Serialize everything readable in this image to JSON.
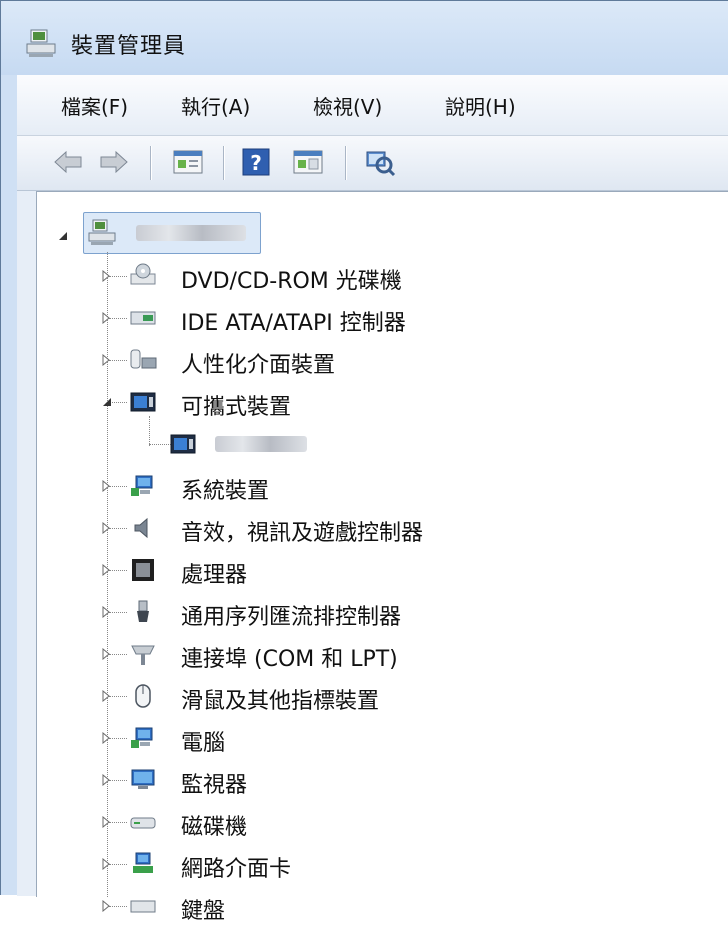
{
  "window": {
    "title": "裝置管理員"
  },
  "menu": [
    "檔案(F)",
    "執行(A)",
    "檢視(V)",
    "說明(H)"
  ],
  "toolbar": [
    "back-icon",
    "forward-icon",
    "properties-icon",
    "help-icon",
    "action-pane-icon",
    "scan-hardware-icon"
  ],
  "tree": {
    "root": {
      "label": "",
      "expanded": true
    },
    "items": [
      {
        "label": "DVD/CD-ROM 光碟機",
        "icon": "dvd-drive-icon",
        "expanded": false
      },
      {
        "label": "IDE ATA/ATAPI 控制器",
        "icon": "ide-controller-icon",
        "expanded": false
      },
      {
        "label": "人性化介面裝置",
        "icon": "hid-icon",
        "expanded": false
      },
      {
        "label": "可攜式裝置",
        "icon": "portable-device-icon",
        "expanded": true
      },
      {
        "label": "",
        "icon": "portable-device-icon",
        "child": true
      },
      {
        "label": "系統裝置",
        "icon": "system-device-icon",
        "expanded": false
      },
      {
        "label": "音效，視訊及遊戲控制器",
        "icon": "speaker-icon",
        "expanded": false
      },
      {
        "label": "處理器",
        "icon": "processor-icon",
        "expanded": false
      },
      {
        "label": "通用序列匯流排控制器",
        "icon": "usb-icon",
        "expanded": false
      },
      {
        "label": "連接埠 (COM 和 LPT)",
        "icon": "port-icon",
        "expanded": false
      },
      {
        "label": "滑鼠及其他指標裝置",
        "icon": "mouse-icon",
        "expanded": false
      },
      {
        "label": "電腦",
        "icon": "computer-icon",
        "expanded": false
      },
      {
        "label": "監視器",
        "icon": "monitor-icon",
        "expanded": false
      },
      {
        "label": "磁碟機",
        "icon": "disk-drive-icon",
        "expanded": false
      },
      {
        "label": "網路介面卡",
        "icon": "network-adapter-icon",
        "expanded": false
      },
      {
        "label": "鍵盤",
        "icon": "keyboard-icon",
        "expanded": false
      }
    ]
  }
}
